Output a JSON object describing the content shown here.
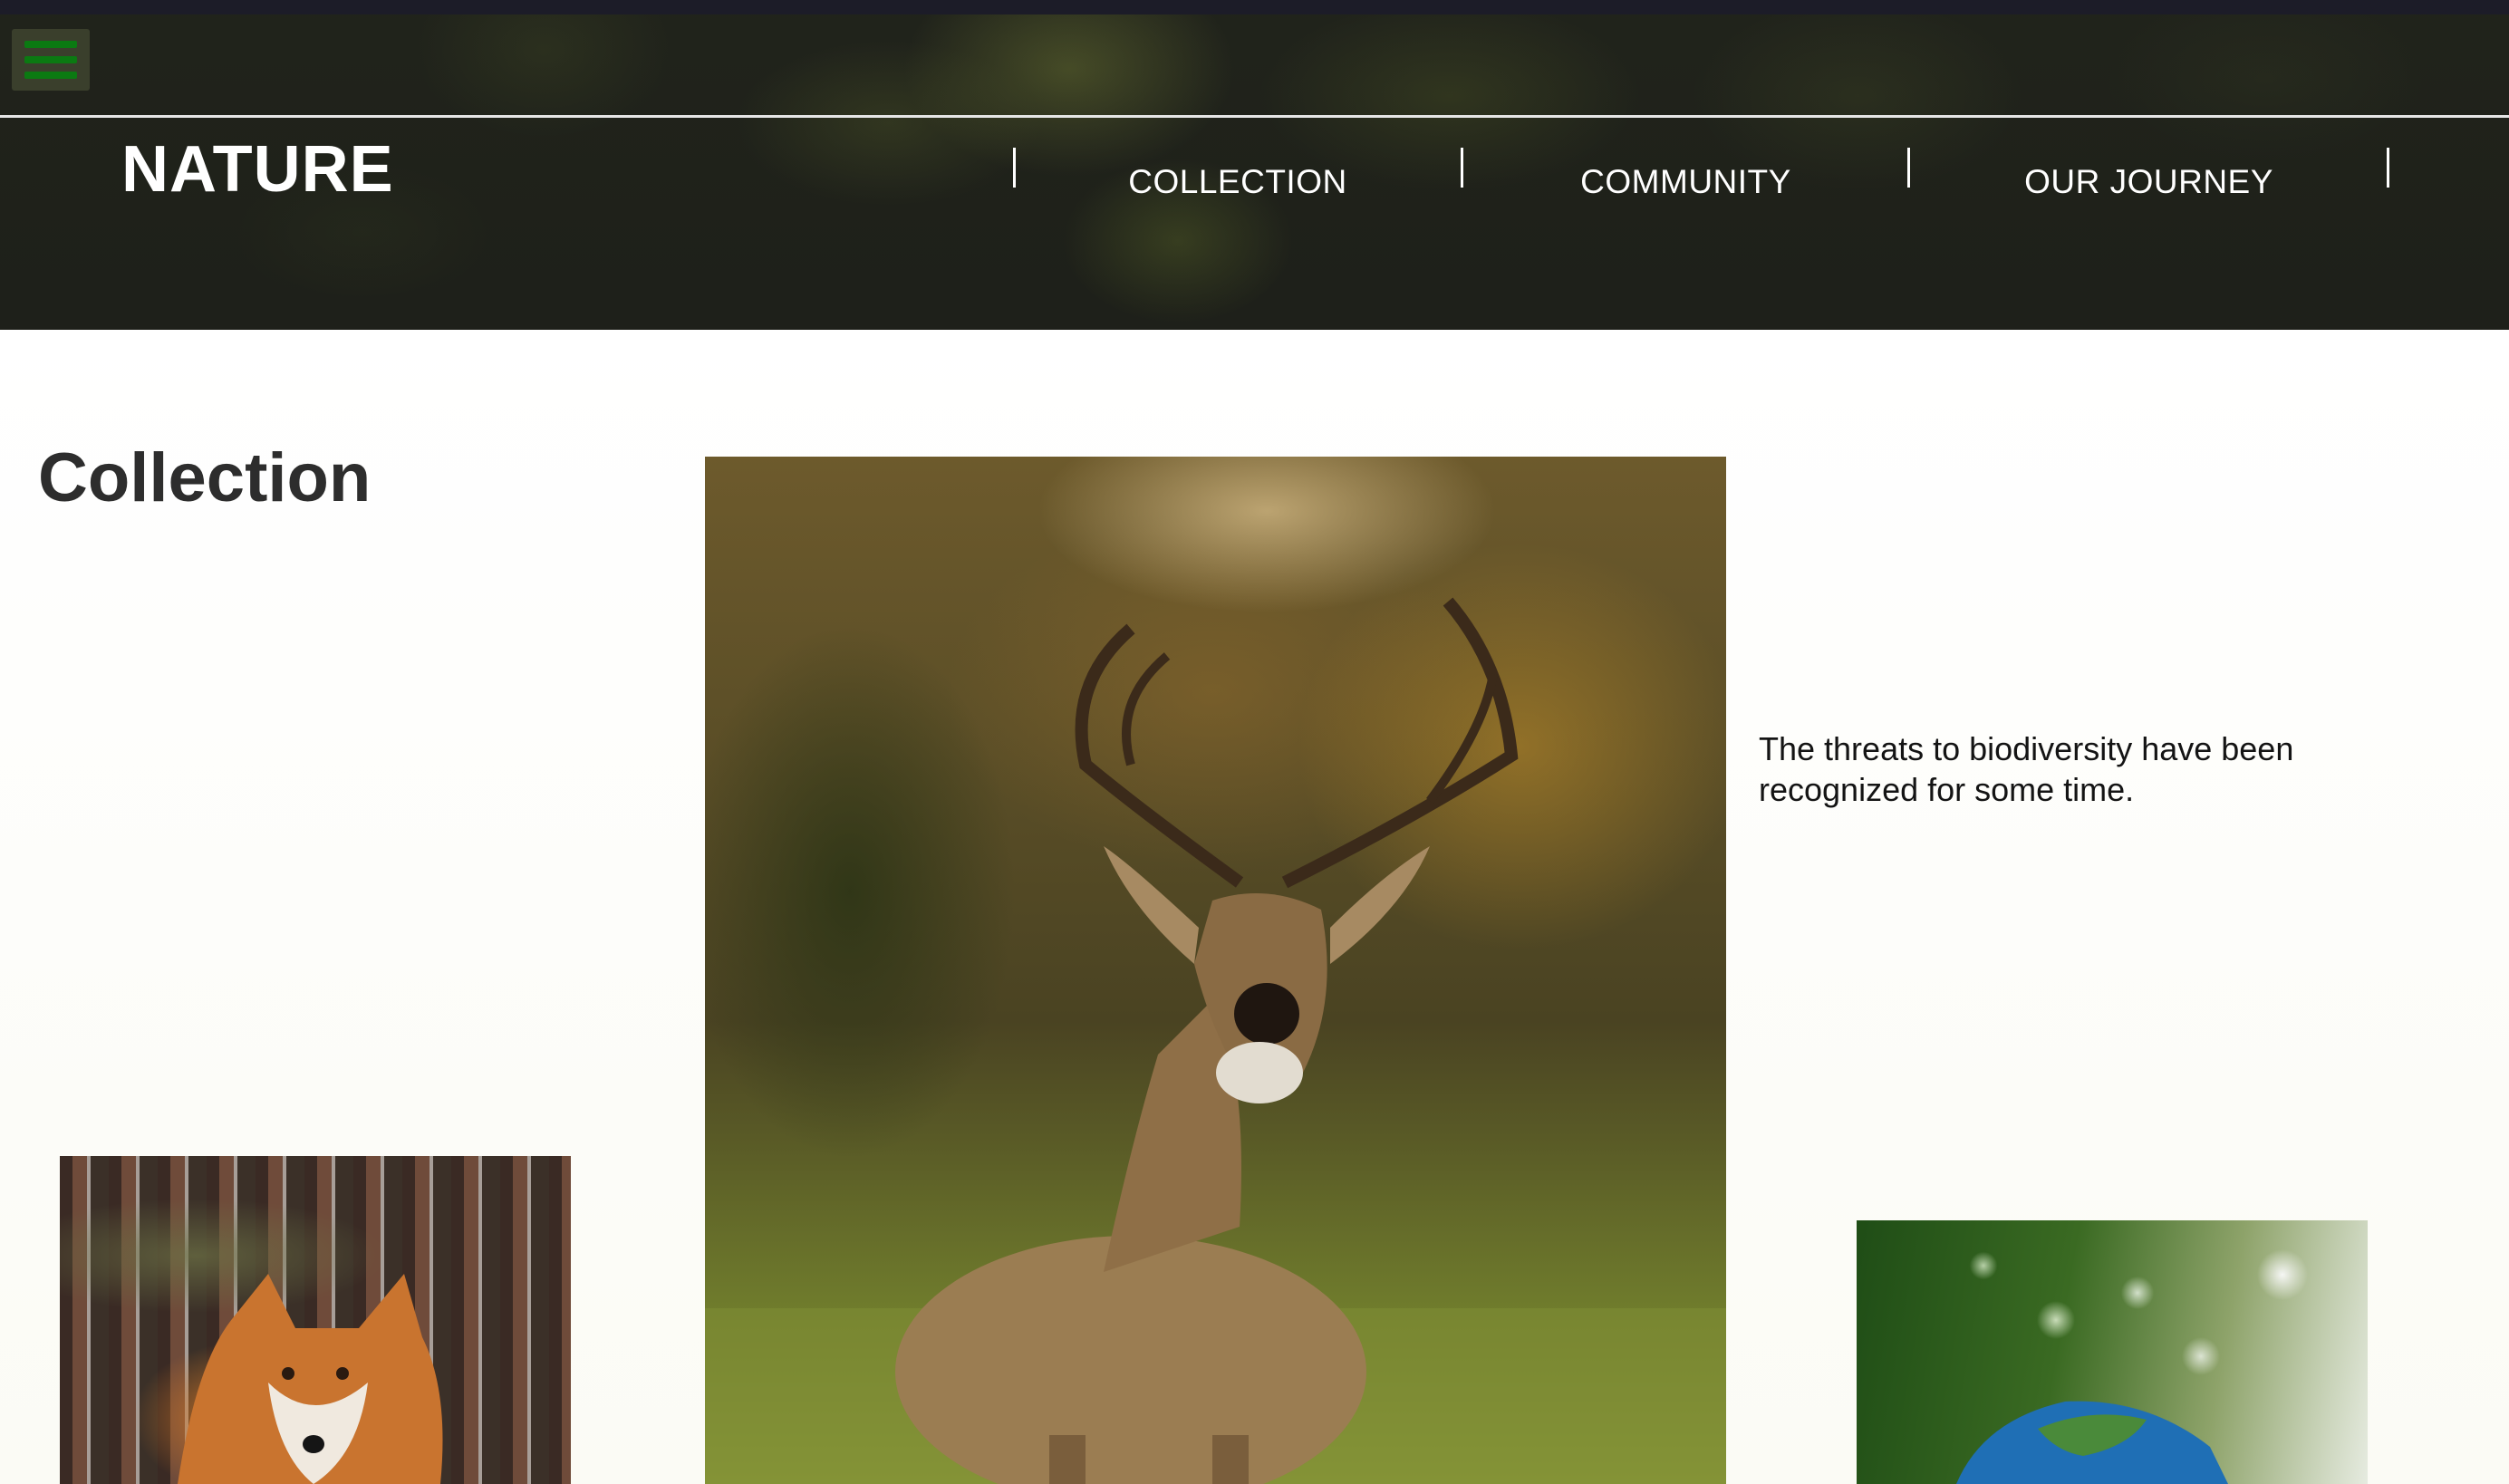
{
  "header": {
    "brand": "NATURE",
    "menu_icon": "hamburger-menu-icon",
    "nav": [
      {
        "label": "COLLECTION"
      },
      {
        "label": "COMMUNITY"
      },
      {
        "label": "OUR JOURNEY"
      }
    ]
  },
  "main": {
    "section_title": "Collection",
    "intro_text": "The threats to biodiversity have been recognized for some time.",
    "images": [
      {
        "name": "deer-photo",
        "subject": "white-tailed deer buck at sunset"
      },
      {
        "name": "fox-photo",
        "subject": "red fox in forest"
      },
      {
        "name": "parrot-photo",
        "subject": "blue and green macaw"
      }
    ]
  },
  "colors": {
    "top_strip": "#1c1c28",
    "header_dark": "#22251c",
    "menu_icon_green": "#0b7a12",
    "page_background": "#fdfdf9",
    "heading_text": "#2d2d2d",
    "body_text": "#141414"
  }
}
